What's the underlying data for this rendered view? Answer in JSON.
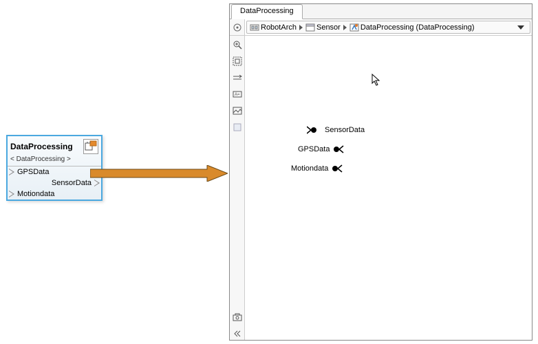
{
  "leftBox": {
    "title": "DataProcessing",
    "subtitle": "< DataProcessing >",
    "ports": {
      "gps": "GPSData",
      "sensor": "SensorData",
      "motion": "Motiondata"
    }
  },
  "panel": {
    "tabLabel": "DataProcessing",
    "breadcrumb": {
      "item1": "RobotArch",
      "item2": "Sensor",
      "item3": "DataProcessing (DataProcessing)"
    },
    "canvasPorts": {
      "sensor": "SensorData",
      "gps": "GPSData",
      "motion": "Motiondata"
    }
  }
}
